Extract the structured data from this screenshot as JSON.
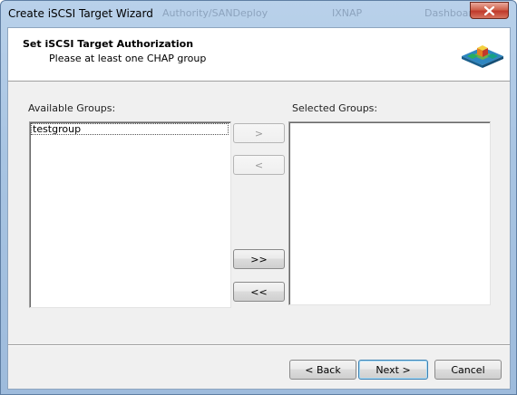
{
  "window": {
    "title": "Create iSCSI Target Wizard",
    "background_title_fragments": [
      "Authority/SANDeploy",
      "IXNAP",
      "Dashboard"
    ]
  },
  "header": {
    "title": "Set iSCSI Target Authorization",
    "subtitle": "Please at least one CHAP group",
    "logo_icon": "stacked-cubes-icon"
  },
  "available_groups": {
    "label": "Available Groups:",
    "items": [
      "testgroup"
    ]
  },
  "selected_groups": {
    "label": "Selected Groups:",
    "items": []
  },
  "transfer_buttons": {
    "add": ">",
    "remove": "<",
    "add_all": ">>",
    "remove_all": "<<"
  },
  "footer": {
    "back": "< Back",
    "next": "Next >",
    "cancel": "Cancel"
  },
  "colors": {
    "close_button": "#c0392b",
    "default_button_border": "#3c7fb1"
  }
}
